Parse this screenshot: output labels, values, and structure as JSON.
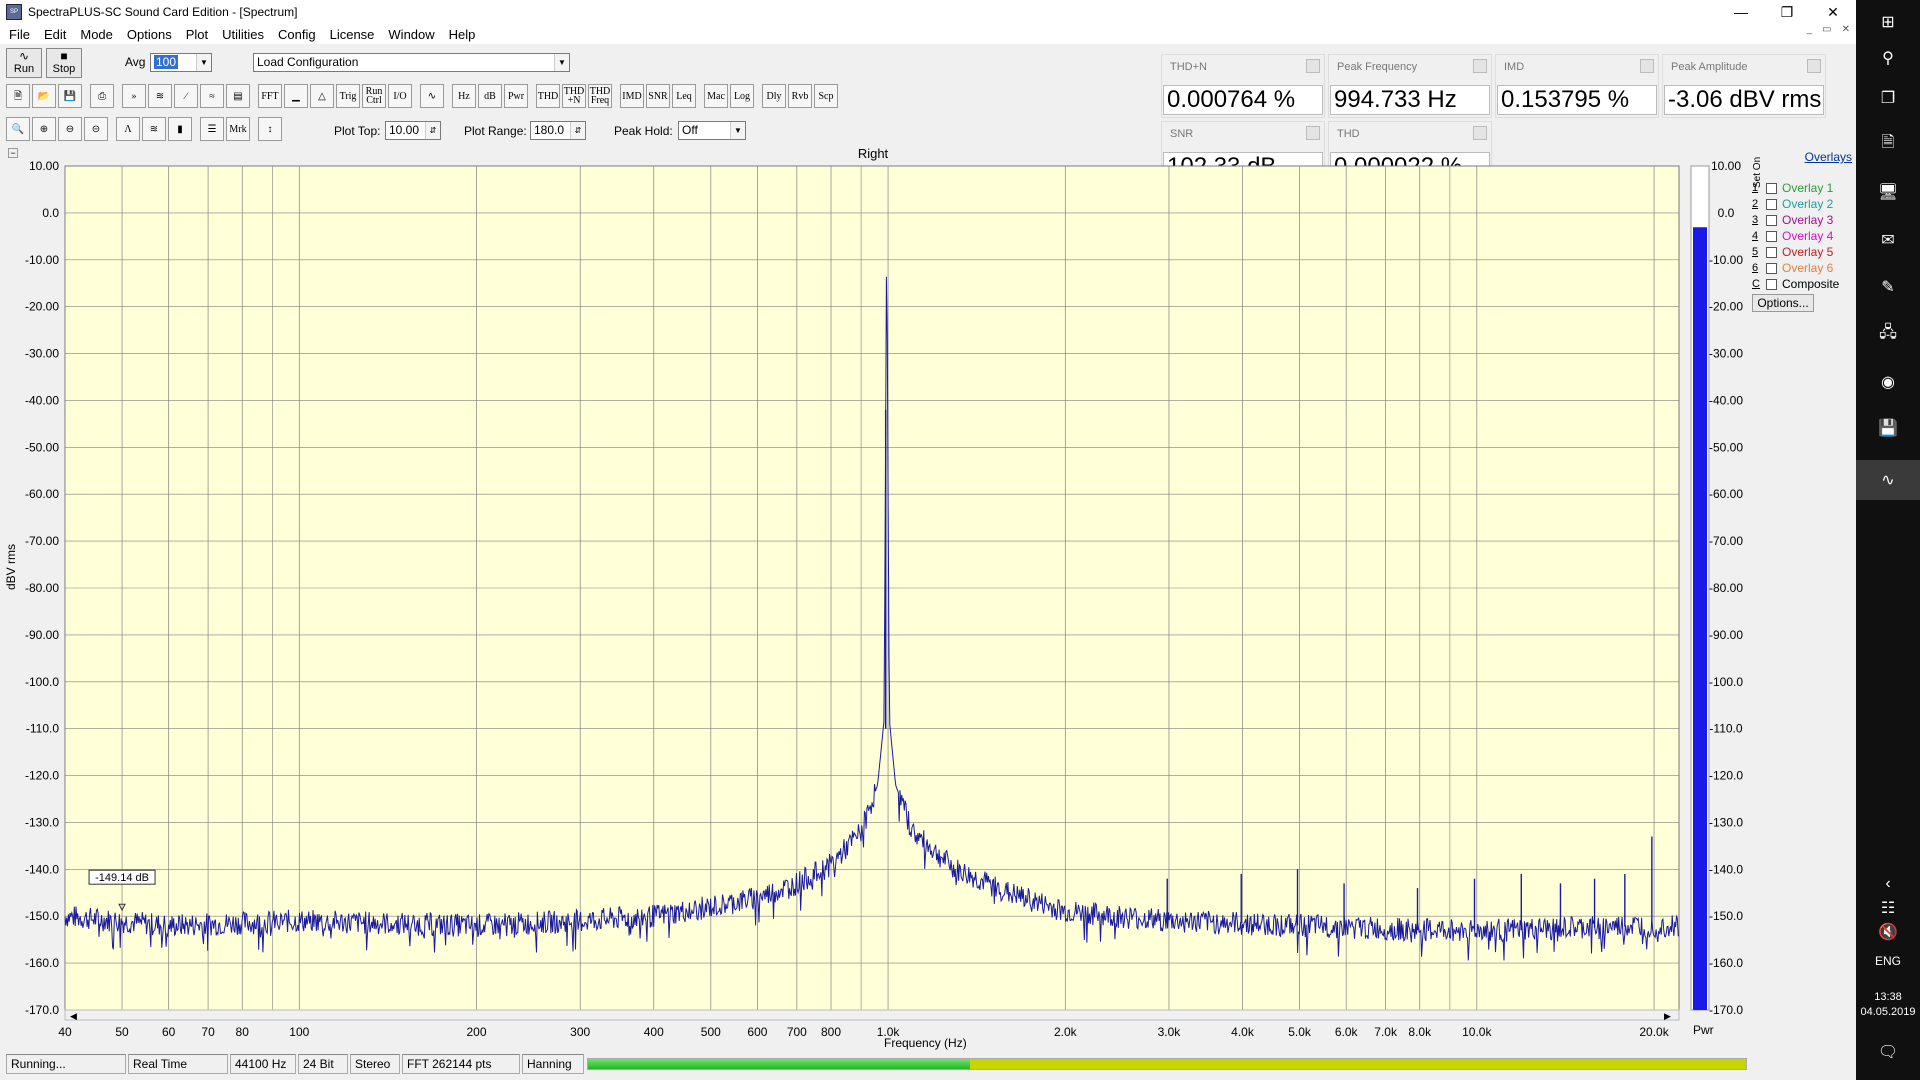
{
  "window": {
    "title": "SpectraPLUS-SC Sound Card Edition - [Spectrum]"
  },
  "menu": [
    "File",
    "Edit",
    "Mode",
    "Options",
    "Plot",
    "Utilities",
    "Config",
    "License",
    "Window",
    "Help"
  ],
  "toolbar": {
    "run_label": "Run",
    "stop_label": "Stop",
    "avg_label": "Avg",
    "avg_value": "100",
    "config_value": "Load Configuration",
    "row2_buttons": [
      "FFT",
      "Trig",
      "Run Ctrl",
      "I/O",
      "Hz",
      "dB",
      "Pwr",
      "THD",
      "THD +N",
      "THD Freq",
      "IMD",
      "SNR",
      "Leq",
      "Mac",
      "Log",
      "Dly",
      "Rvb",
      "Scp"
    ],
    "row3_buttons": [
      "Mrk"
    ],
    "plot_top_label": "Plot Top:",
    "plot_top_value": "10.00",
    "plot_range_label": "Plot Range:",
    "plot_range_value": "180.0",
    "peak_hold_label": "Peak Hold:",
    "peak_hold_value": "Off"
  },
  "meters": [
    {
      "label": "THD+N",
      "value": "0.000764 %"
    },
    {
      "label": "Peak Frequency",
      "value": "994.733 Hz"
    },
    {
      "label": "IMD",
      "value": "0.153795 %"
    },
    {
      "label": "Peak Amplitude",
      "value": "-3.06 dBV rms"
    },
    {
      "label": "SNR",
      "value": "102.33 dB"
    },
    {
      "label": "THD",
      "value": "0.000022 %"
    }
  ],
  "plot": {
    "title": "Right",
    "marker_label": "-149.14 dB",
    "pwr_label": "Pwr",
    "colors": {
      "background": "#ffffd8",
      "trace": "#1a1aa0",
      "bar": "#1a1ae6",
      "grid": "#808080"
    }
  },
  "overlays": {
    "header": "Overlays",
    "set_on_label": "Set On",
    "items": [
      {
        "num": "1",
        "label": "Overlay 1",
        "color": "#2e9c3a"
      },
      {
        "num": "2",
        "label": "Overlay 2",
        "color": "#20a0a0"
      },
      {
        "num": "3",
        "label": "Overlay 3",
        "color": "#a01090"
      },
      {
        "num": "4",
        "label": "Overlay 4",
        "color": "#d010d0"
      },
      {
        "num": "5",
        "label": "Overlay 5",
        "color": "#c02020"
      },
      {
        "num": "6",
        "label": "Overlay 6",
        "color": "#e08040"
      },
      {
        "num": "C",
        "label": "Composite",
        "color": "#000000"
      }
    ],
    "options_label": "Options..."
  },
  "status": {
    "state": "Running...",
    "mode": "Real Time",
    "rate": "44100 Hz",
    "bits": "24 Bit",
    "channels": "Stereo",
    "fft": "FFT 262144 pts",
    "window": "Hanning",
    "level_fraction": 0.33
  },
  "taskbar": {
    "lang": "ENG",
    "time": "13:38",
    "date": "04.05.2019"
  },
  "chart_data": {
    "type": "line",
    "title": "Right",
    "xlabel": "Frequency (Hz)",
    "ylabel": "dBV rms",
    "xscale": "log",
    "xlim": [
      40,
      22050
    ],
    "ylim": [
      -170,
      10
    ],
    "x_ticks": [
      "40",
      "50",
      "60",
      "70",
      "80",
      "100",
      "200",
      "300",
      "400",
      "500",
      "600",
      "700",
      "800",
      "1.0k",
      "2.0k",
      "3.0k",
      "4.0k",
      "5.0k",
      "6.0k",
      "7.0k",
      "8.0k",
      "10.0k",
      "20.0k"
    ],
    "y_ticks": [
      "10.00",
      "0.0",
      "-10.00",
      "-20.00",
      "-30.00",
      "-40.00",
      "-50.00",
      "-60.00",
      "-70.00",
      "-80.00",
      "-90.00",
      "-100.0",
      "-110.0",
      "-120.0",
      "-130.0",
      "-140.0",
      "-150.0",
      "-160.0",
      "-170.0"
    ],
    "grid": true,
    "series": [
      {
        "values": [
          {
            "x": 40,
            "y": -150
          },
          {
            "x": 60,
            "y": -152
          },
          {
            "x": 100,
            "y": -151
          },
          {
            "x": 200,
            "y": -152
          },
          {
            "x": 300,
            "y": -151
          },
          {
            "x": 400,
            "y": -150
          },
          {
            "x": 500,
            "y": -148
          },
          {
            "x": 600,
            "y": -146
          },
          {
            "x": 700,
            "y": -143
          },
          {
            "x": 800,
            "y": -139
          },
          {
            "x": 900,
            "y": -132
          },
          {
            "x": 960,
            "y": -122
          },
          {
            "x": 985,
            "y": -108
          },
          {
            "x": 994.7,
            "y": -3.06
          },
          {
            "x": 1005,
            "y": -108
          },
          {
            "x": 1030,
            "y": -122
          },
          {
            "x": 1100,
            "y": -132
          },
          {
            "x": 1300,
            "y": -140
          },
          {
            "x": 1600,
            "y": -145
          },
          {
            "x": 2000,
            "y": -149
          },
          {
            "x": 3000,
            "y": -151
          },
          {
            "x": 5000,
            "y": -152
          },
          {
            "x": 8000,
            "y": -153
          },
          {
            "x": 12000,
            "y": -153
          },
          {
            "x": 20000,
            "y": -152
          },
          {
            "x": 22050,
            "y": -152
          }
        ]
      }
    ],
    "peaks": [
      {
        "x": 994.7,
        "y": -3.06
      },
      {
        "x": 2980,
        "y": -142
      },
      {
        "x": 3980,
        "y": -141
      },
      {
        "x": 4960,
        "y": -140
      },
      {
        "x": 5950,
        "y": -143
      },
      {
        "x": 7930,
        "y": -144
      },
      {
        "x": 9910,
        "y": -142
      },
      {
        "x": 11900,
        "y": -141
      },
      {
        "x": 13870,
        "y": -143
      },
      {
        "x": 15850,
        "y": -142
      },
      {
        "x": 17840,
        "y": -141
      },
      {
        "x": 19830,
        "y": -133
      }
    ],
    "marker": {
      "x": 50,
      "y": -149.14
    }
  }
}
